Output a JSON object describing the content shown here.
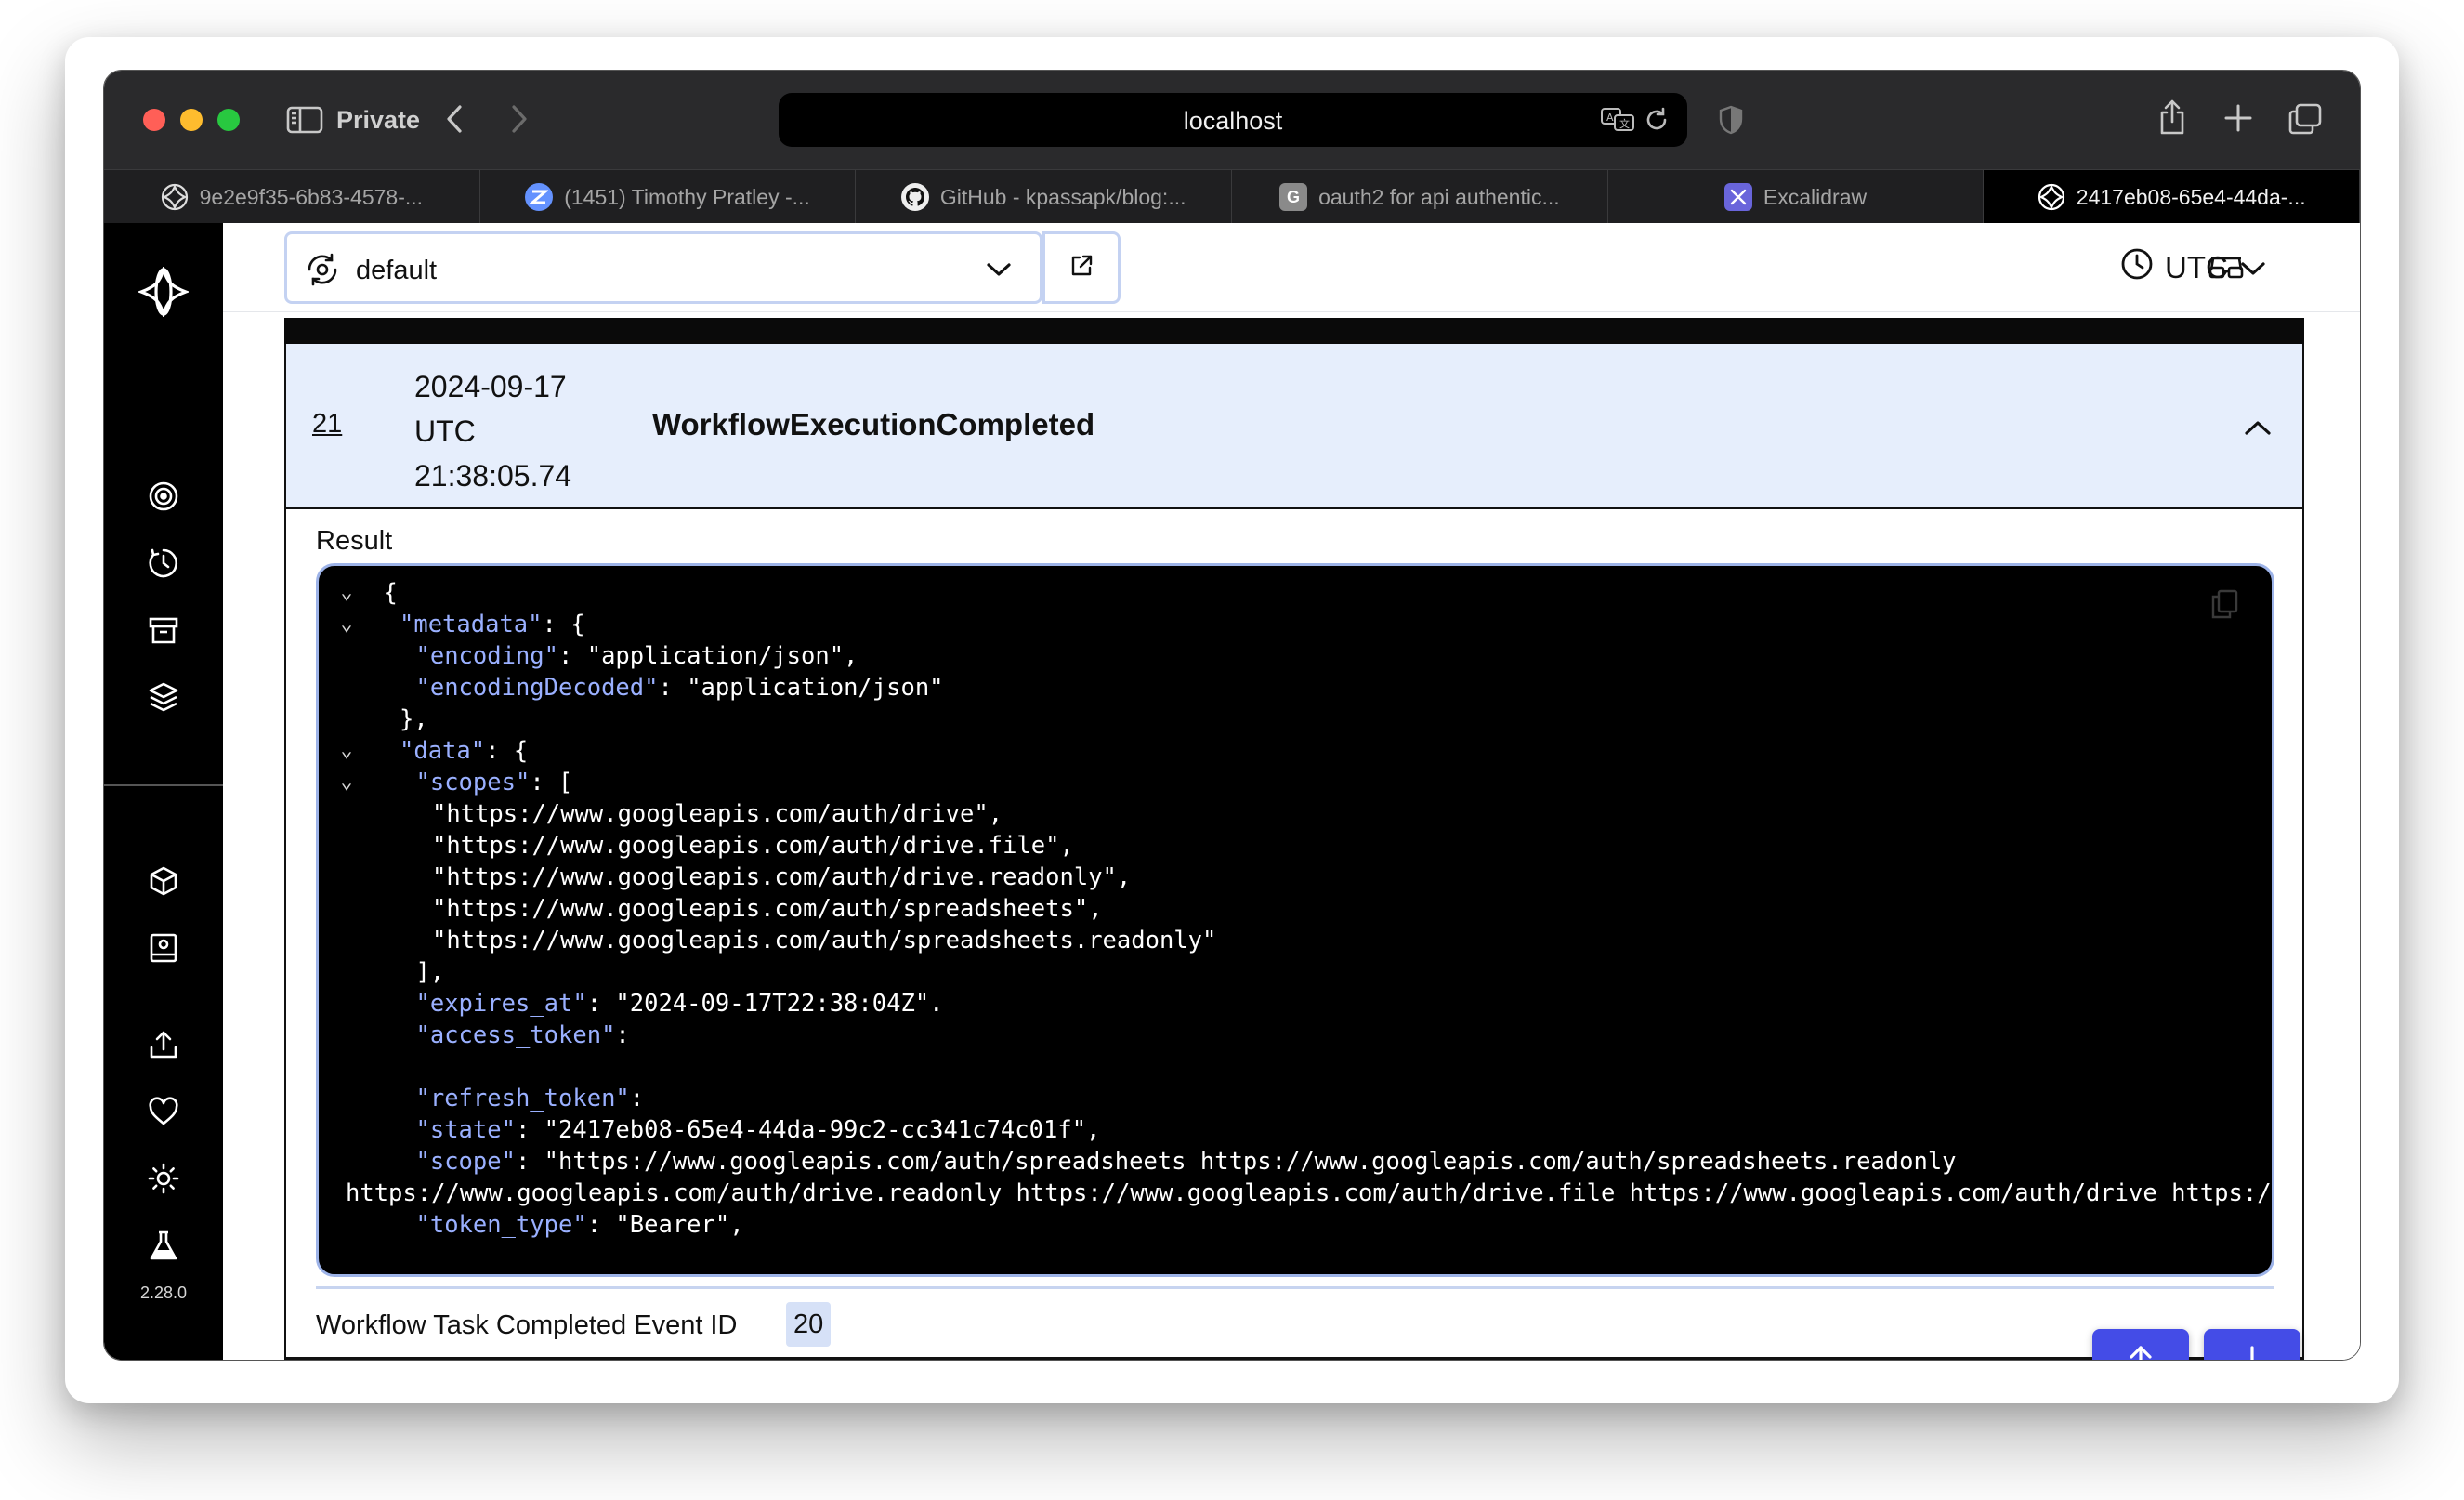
{
  "browser": {
    "private_label": "Private",
    "address": "localhost",
    "tabs": [
      {
        "title": "9e2e9f35-6b83-4578-...",
        "favicon": "temporal-icon"
      },
      {
        "title": "(1451) Timothy Pratley -...",
        "favicon": "zulip-icon"
      },
      {
        "title": "GitHub - kpassapk/blog:...",
        "favicon": "github-icon"
      },
      {
        "title": "oauth2 for api authentic...",
        "favicon": "g-letter-icon"
      },
      {
        "title": "Excalidraw",
        "favicon": "excalidraw-icon"
      },
      {
        "title": "2417eb08-65e4-44da-...",
        "favicon": "temporal-icon",
        "active": true
      }
    ]
  },
  "app": {
    "version": "2.28.0",
    "namespace": "default",
    "timezone": "UTC",
    "nav_icons": [
      "temporal-logo-icon",
      "workflows-icon",
      "schedules-icon",
      "archive-icon",
      "layers-icon",
      "namespaces-icon",
      "nexus-icon",
      "import-icon",
      "feedback-icon",
      "theme-icon",
      "labs-icon"
    ]
  },
  "event": {
    "id": "21",
    "date": "2024-09-17",
    "tz": "UTC",
    "time": "21:38:05.74",
    "type": "WorkflowExecutionCompleted",
    "result_label": "Result",
    "field_label": "Workflow Task Completed Event ID",
    "field_value": "20"
  },
  "code": {
    "top_fragment": "  . .",
    "lines": [
      {
        "fold": true,
        "indent": 2,
        "parts": [
          [
            "p",
            "{"
          ]
        ]
      },
      {
        "fold": true,
        "indent": 4,
        "parts": [
          [
            "k",
            "\"metadata\""
          ],
          [
            "p",
            ": {"
          ]
        ]
      },
      {
        "fold": false,
        "indent": 6,
        "parts": [
          [
            "k",
            "\"encoding\""
          ],
          [
            "p",
            ": \"application/json\","
          ]
        ]
      },
      {
        "fold": false,
        "indent": 6,
        "parts": [
          [
            "k",
            "\"encodingDecoded\""
          ],
          [
            "p",
            ": \"application/json\""
          ]
        ]
      },
      {
        "fold": false,
        "indent": 4,
        "parts": [
          [
            "p",
            "},"
          ]
        ]
      },
      {
        "fold": true,
        "indent": 4,
        "parts": [
          [
            "k",
            "\"data\""
          ],
          [
            "p",
            ": {"
          ]
        ]
      },
      {
        "fold": true,
        "indent": 6,
        "parts": [
          [
            "k",
            "\"scopes\""
          ],
          [
            "p",
            ": ["
          ]
        ]
      },
      {
        "fold": false,
        "indent": 8,
        "parts": [
          [
            "p",
            "\"https://www.googleapis.com/auth/drive\","
          ]
        ]
      },
      {
        "fold": false,
        "indent": 8,
        "parts": [
          [
            "p",
            "\"https://www.googleapis.com/auth/drive.file\","
          ]
        ]
      },
      {
        "fold": false,
        "indent": 8,
        "parts": [
          [
            "p",
            "\"https://www.googleapis.com/auth/drive.readonly\","
          ]
        ]
      },
      {
        "fold": false,
        "indent": 8,
        "parts": [
          [
            "p",
            "\"https://www.googleapis.com/auth/spreadsheets\","
          ]
        ]
      },
      {
        "fold": false,
        "indent": 8,
        "parts": [
          [
            "p",
            "\"https://www.googleapis.com/auth/spreadsheets.readonly\""
          ]
        ]
      },
      {
        "fold": false,
        "indent": 6,
        "parts": [
          [
            "p",
            "],"
          ]
        ]
      },
      {
        "fold": false,
        "indent": 6,
        "parts": [
          [
            "k",
            "\"expires_at\""
          ],
          [
            "p",
            ": \"2024-09-17T22:38:04Z\"."
          ]
        ]
      },
      {
        "fold": false,
        "indent": 6,
        "parts": [
          [
            "k",
            "\"access_token\""
          ],
          [
            "p",
            ":"
          ]
        ]
      },
      {
        "fold": false,
        "indent": 6,
        "parts": [
          [
            "p",
            ""
          ]
        ]
      },
      {
        "fold": false,
        "indent": 6,
        "parts": [
          [
            "k",
            "\"refresh_token\""
          ],
          [
            "p",
            ":"
          ]
        ]
      },
      {
        "fold": false,
        "indent": 6,
        "parts": [
          [
            "k",
            "\"state\""
          ],
          [
            "p",
            ": \"2417eb08-65e4-44da-99c2-cc341c74c01f\","
          ]
        ]
      },
      {
        "fold": false,
        "indent": 6,
        "parts": [
          [
            "k",
            "\"scope\""
          ],
          [
            "p",
            ": \"https://www.googleapis.com/auth/spreadsheets https://www.googleapis.com/auth/spreadsheets.readonly"
          ]
        ]
      },
      {
        "fold": false,
        "indent": 0,
        "parts": [
          [
            "p",
            "https://www.googleapis.com/auth/drive.readonly https://www.googleapis.com/auth/drive.file https://www.googleapis.com/auth/drive https://www.googleapis.com/auth/drive\","
          ]
        ]
      },
      {
        "fold": false,
        "indent": 6,
        "parts": [
          [
            "k",
            "\"token_type\""
          ],
          [
            "p",
            ": \"Bearer\","
          ]
        ]
      }
    ]
  },
  "colors": {
    "accent": "#444ce7",
    "json_key": "#9ab0ff",
    "header_bg": "#e6eefc"
  }
}
